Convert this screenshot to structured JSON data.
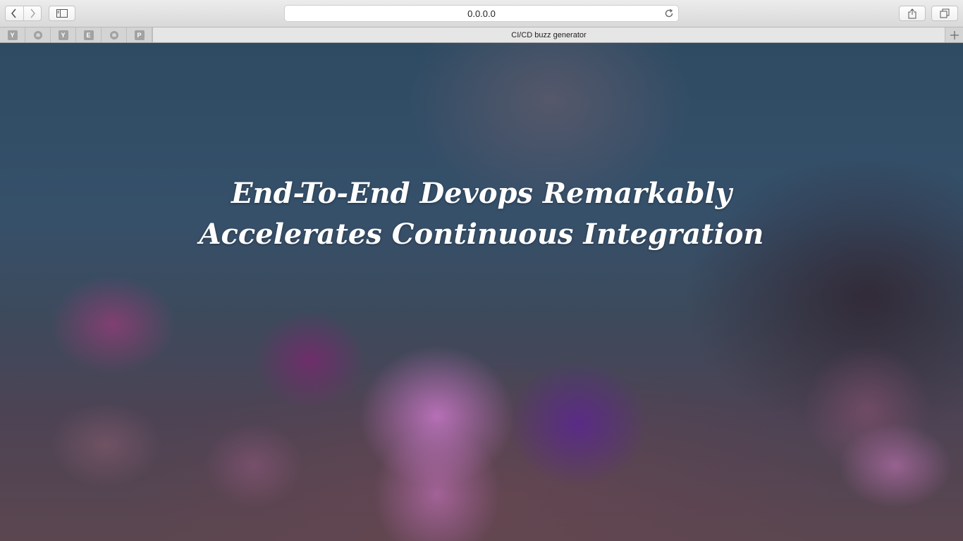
{
  "browser": {
    "address": "0.0.0.0",
    "favorites": [
      {
        "letter": "Y",
        "icon": "y-favicon"
      },
      {
        "letter": "",
        "icon": "github-icon"
      },
      {
        "letter": "Y",
        "icon": "y-favicon"
      },
      {
        "letter": "E",
        "icon": "e-favicon"
      },
      {
        "letter": "",
        "icon": "github-icon"
      },
      {
        "letter": "P",
        "icon": "p-favicon"
      }
    ],
    "active_tab_title": "CI/CD buzz generator"
  },
  "page": {
    "headline_line1": "End-To-End Devops Remarkably",
    "headline_line2": "Accelerates Continuous Integration"
  }
}
